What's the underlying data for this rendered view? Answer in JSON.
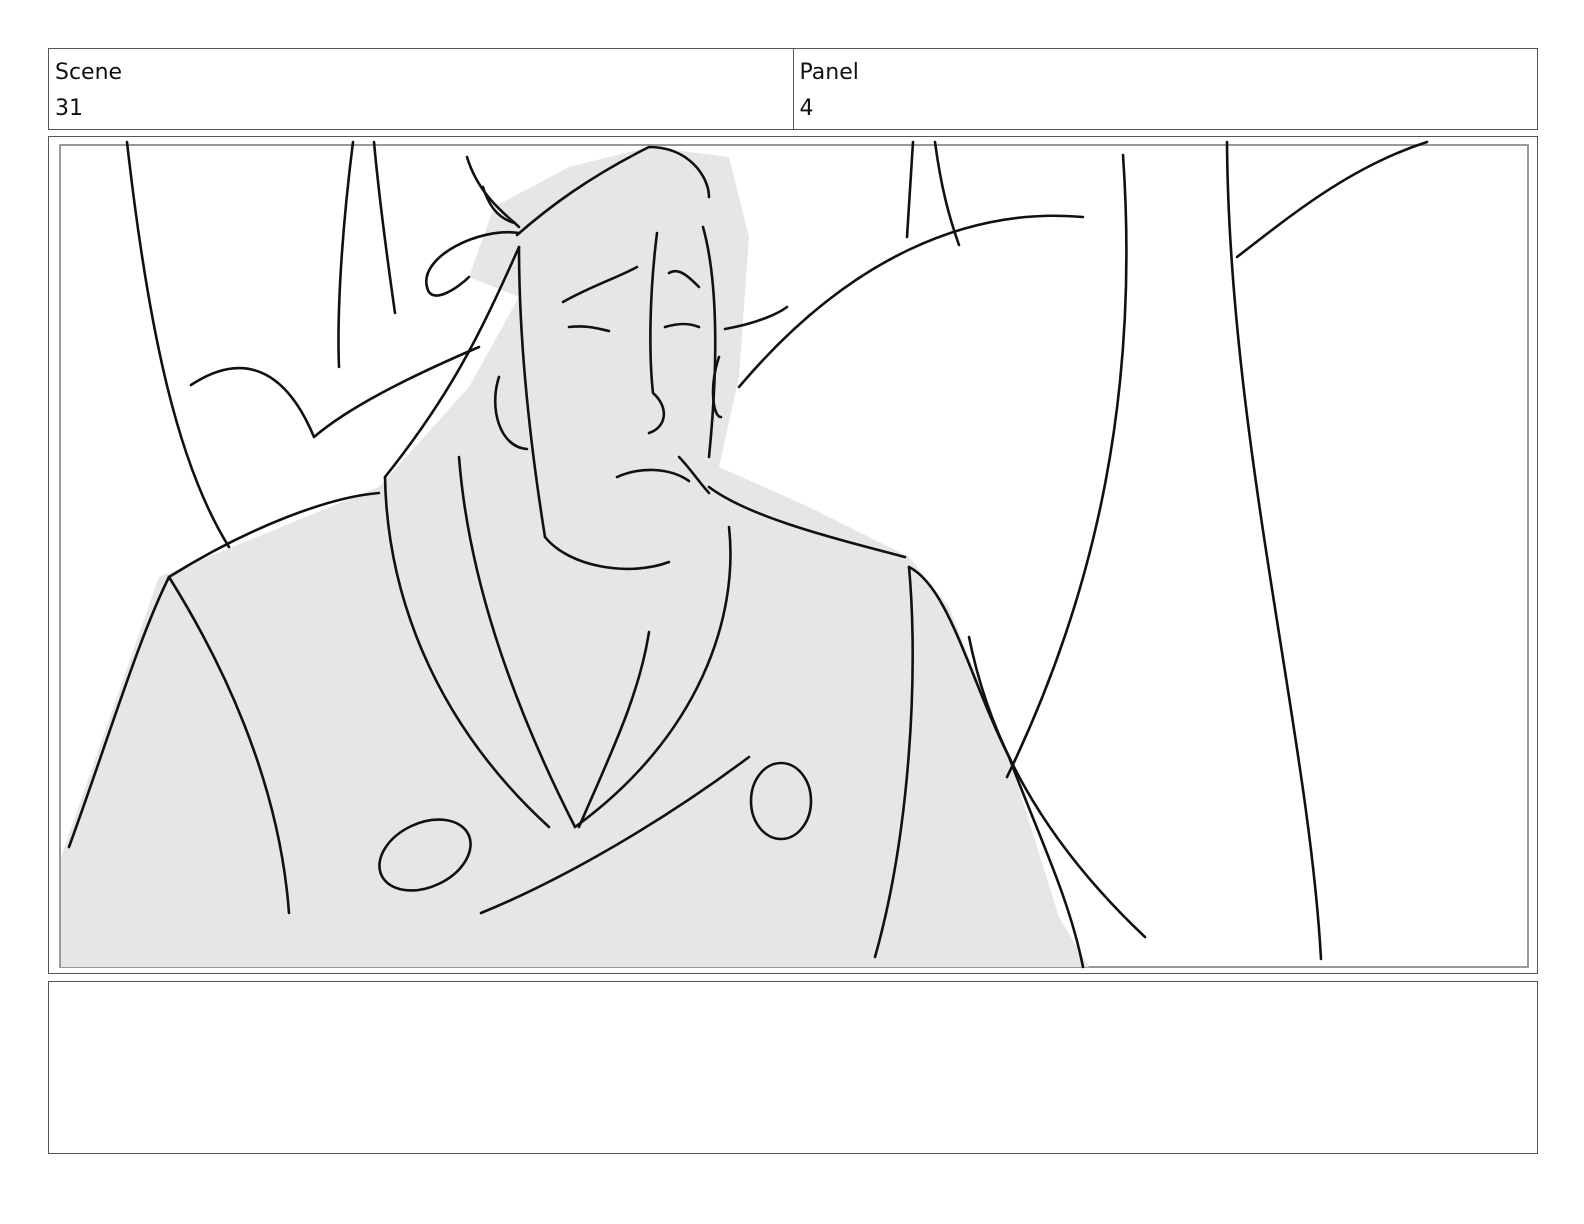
{
  "header": {
    "scene_label": "Scene",
    "scene_value": "31",
    "panel_label": "Panel",
    "panel_value": "4"
  },
  "notes": {
    "text": ""
  },
  "colors": {
    "frame_border": "#555555",
    "sketch_fill": "#e6e6e6",
    "sketch_line": "#111111"
  }
}
